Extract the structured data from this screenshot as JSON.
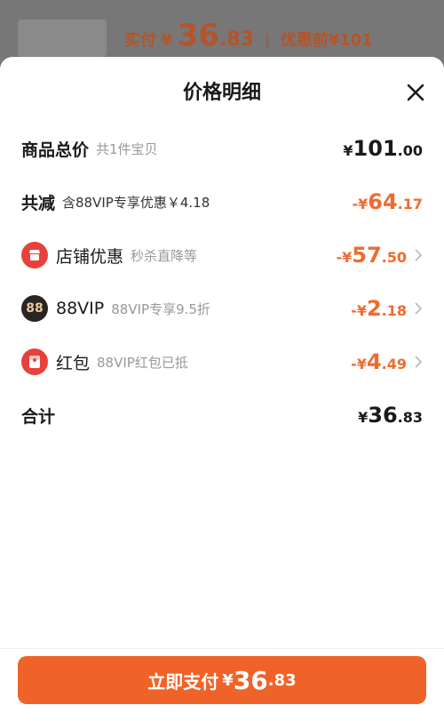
{
  "background": {
    "label": "实付",
    "currency": "¥",
    "price_int": "36",
    "price_dec": ".83",
    "separator": "|",
    "original": "优惠前¥101"
  },
  "sheet": {
    "title": "价格明细"
  },
  "rows": {
    "total": {
      "label": "商品总价",
      "sub": "共1件宝贝",
      "cur": "¥",
      "int": "101",
      "dec": ".00"
    },
    "reduce": {
      "label": "共减",
      "sub": "含88VIP专享优惠￥4.18",
      "cur": "-¥",
      "int": "64",
      "dec": ".17"
    },
    "store": {
      "label": "店铺优惠",
      "sub": "秒杀直降等",
      "cur": "-¥",
      "int": "57",
      "dec": ".50"
    },
    "vip": {
      "label": "88VIP",
      "sub": "88VIP专享9.5折",
      "icon_text": "88",
      "cur": "-¥",
      "int": "2",
      "dec": ".18"
    },
    "redpacket": {
      "label": "红包",
      "sub": "88VIP红包已抵",
      "cur": "-¥",
      "int": "4",
      "dec": ".49"
    },
    "sum": {
      "label": "合计",
      "cur": "¥",
      "int": "36",
      "dec": ".83"
    }
  },
  "pay_button": {
    "label": "立即支付",
    "cur": "¥",
    "int": "36",
    "dec": ".83"
  },
  "colors": {
    "accent": "#f06a2e",
    "button": "#f06328",
    "store_icon": "#e8413b",
    "vip_icon": "#2a2422",
    "redpacket_icon": "#e8413b"
  }
}
